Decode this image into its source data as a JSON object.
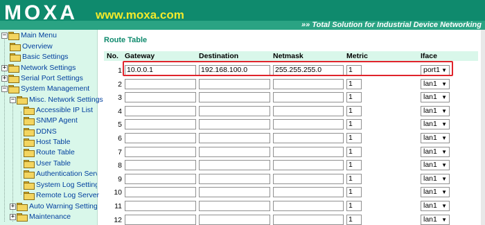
{
  "header": {
    "logo": "MOXA",
    "site_url": "www.moxa.com",
    "tagline": "»» Total Solution for Industrial Device Networking"
  },
  "sidebar": {
    "items": [
      {
        "label": "Main Menu",
        "expander": "−",
        "icon": "folder-icon"
      },
      {
        "label": "Overview",
        "expander": "",
        "icon": "folder-icon"
      },
      {
        "label": "Basic Settings",
        "expander": "",
        "icon": "folder-icon"
      },
      {
        "label": "Network Settings",
        "expander": "+",
        "icon": "folder-icon"
      },
      {
        "label": "Serial Port Settings",
        "expander": "+",
        "icon": "folder-icon"
      },
      {
        "label": "System Management",
        "expander": "−",
        "icon": "folder-icon"
      },
      {
        "label": "Misc. Network Settings",
        "expander": "−",
        "icon": "folder-icon"
      },
      {
        "label": "Accessible IP List",
        "expander": "",
        "icon": "folder-icon"
      },
      {
        "label": "SNMP Agent",
        "expander": "",
        "icon": "folder-icon"
      },
      {
        "label": "DDNS",
        "expander": "",
        "icon": "folder-icon"
      },
      {
        "label": "Host Table",
        "expander": "",
        "icon": "folder-icon"
      },
      {
        "label": "Route Table",
        "expander": "",
        "icon": "folder-icon"
      },
      {
        "label": "User Table",
        "expander": "",
        "icon": "folder-icon"
      },
      {
        "label": "Authentication Serve",
        "expander": "",
        "icon": "folder-icon"
      },
      {
        "label": "System Log Settings",
        "expander": "",
        "icon": "folder-icon"
      },
      {
        "label": "Remote Log Server",
        "expander": "",
        "icon": "folder-icon"
      },
      {
        "label": "Auto Warning Settings",
        "expander": "+",
        "icon": "folder-icon"
      },
      {
        "label": "Maintenance",
        "expander": "+",
        "icon": "folder-icon"
      }
    ]
  },
  "main": {
    "title": "Route Table",
    "columns": [
      "No.",
      "Gateway",
      "Destination",
      "Netmask",
      "Metric",
      "Iface"
    ],
    "rows": [
      {
        "no": "1",
        "gateway": "10.0.0.1",
        "destination": "192.168.100.0",
        "netmask": "255.255.255.0",
        "metric": "1",
        "iface": "port1"
      },
      {
        "no": "2",
        "gateway": "",
        "destination": "",
        "netmask": "",
        "metric": "1",
        "iface": "lan1"
      },
      {
        "no": "3",
        "gateway": "",
        "destination": "",
        "netmask": "",
        "metric": "1",
        "iface": "lan1"
      },
      {
        "no": "4",
        "gateway": "",
        "destination": "",
        "netmask": "",
        "metric": "1",
        "iface": "lan1"
      },
      {
        "no": "5",
        "gateway": "",
        "destination": "",
        "netmask": "",
        "metric": "1",
        "iface": "lan1"
      },
      {
        "no": "6",
        "gateway": "",
        "destination": "",
        "netmask": "",
        "metric": "1",
        "iface": "lan1"
      },
      {
        "no": "7",
        "gateway": "",
        "destination": "",
        "netmask": "",
        "metric": "1",
        "iface": "lan1"
      },
      {
        "no": "8",
        "gateway": "",
        "destination": "",
        "netmask": "",
        "metric": "1",
        "iface": "lan1"
      },
      {
        "no": "9",
        "gateway": "",
        "destination": "",
        "netmask": "",
        "metric": "1",
        "iface": "lan1"
      },
      {
        "no": "10",
        "gateway": "",
        "destination": "",
        "netmask": "",
        "metric": "1",
        "iface": "lan1"
      },
      {
        "no": "11",
        "gateway": "",
        "destination": "",
        "netmask": "",
        "metric": "1",
        "iface": "lan1"
      },
      {
        "no": "12",
        "gateway": "",
        "destination": "",
        "netmask": "",
        "metric": "1",
        "iface": "lan1"
      }
    ]
  },
  "colors": {
    "header_green": "#0f8a6d",
    "url_yellow": "#f2ea2c",
    "sidebar_bg": "#d9f7ea",
    "highlight_red": "#e0232b"
  }
}
